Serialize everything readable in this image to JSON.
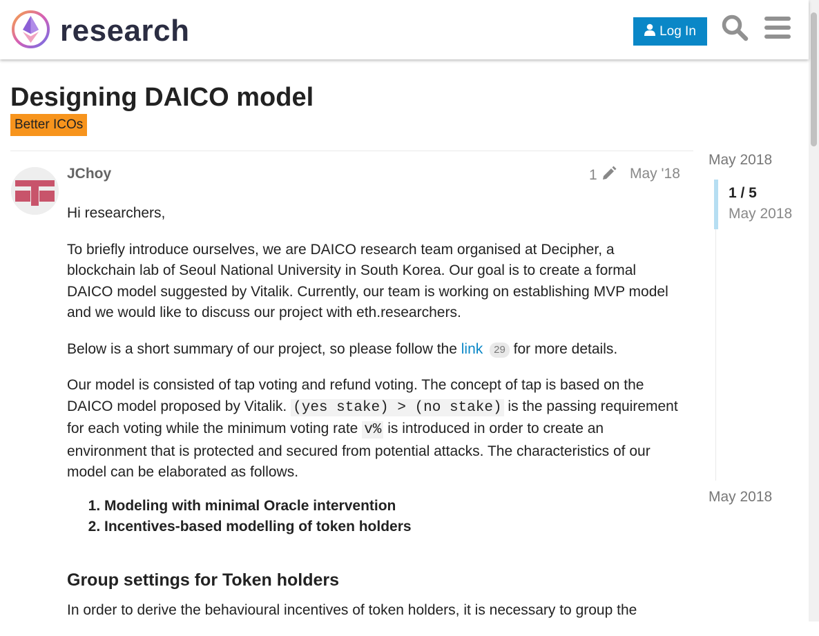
{
  "header": {
    "site_name": "research",
    "login_label": "Log In"
  },
  "topic": {
    "title": "Designing DAICO model",
    "category": "Better ICOs",
    "category_color": "#f7941d"
  },
  "post": {
    "author": "JChoy",
    "edit_count": "1",
    "date": "May '18",
    "greeting": "Hi researchers,",
    "intro": "To briefly introduce ourselves, we are DAICO research team organised at Decipher, a blockchain lab of Seoul National University in South Korea. Our goal is to create a formal DAICO model suggested by Vitalik. Currently, our team is working on establishing MVP model and we would like to discuss our project with eth.researchers.",
    "summary_before": "Below is a short summary of our project, so please follow the ",
    "summary_link": "link",
    "summary_clicks": "29",
    "summary_after": " for more details.",
    "model_p1": "Our model is consisted of tap voting and refund voting. The concept of tap is based on the DAICO model proposed by Vitalik. ",
    "model_code1": "(yes stake) > (no stake)",
    "model_p2": " is the passing requirement for each voting while the minimum voting rate ",
    "model_code2": "v%",
    "model_p3": " is introduced in order to create an environment that is protected and secured from potential attacks. The characteristics of our model can be elaborated as follows.",
    "list": [
      "Modeling with minimal Oracle intervention",
      "Incentives-based modelling of token holders"
    ],
    "heading": "Group settings for Token holders",
    "last_para": "In order to derive the behavioural incentives of token holders, it is necessary to group the"
  },
  "timeline": {
    "top_date": "May 2018",
    "count": "1 / 5",
    "current_date": "May 2018",
    "bottom_date": "May 2018"
  },
  "colors": {
    "accent": "#0a87c7",
    "avatar": "#c8546b",
    "timeline_handle": "#b6def2"
  }
}
